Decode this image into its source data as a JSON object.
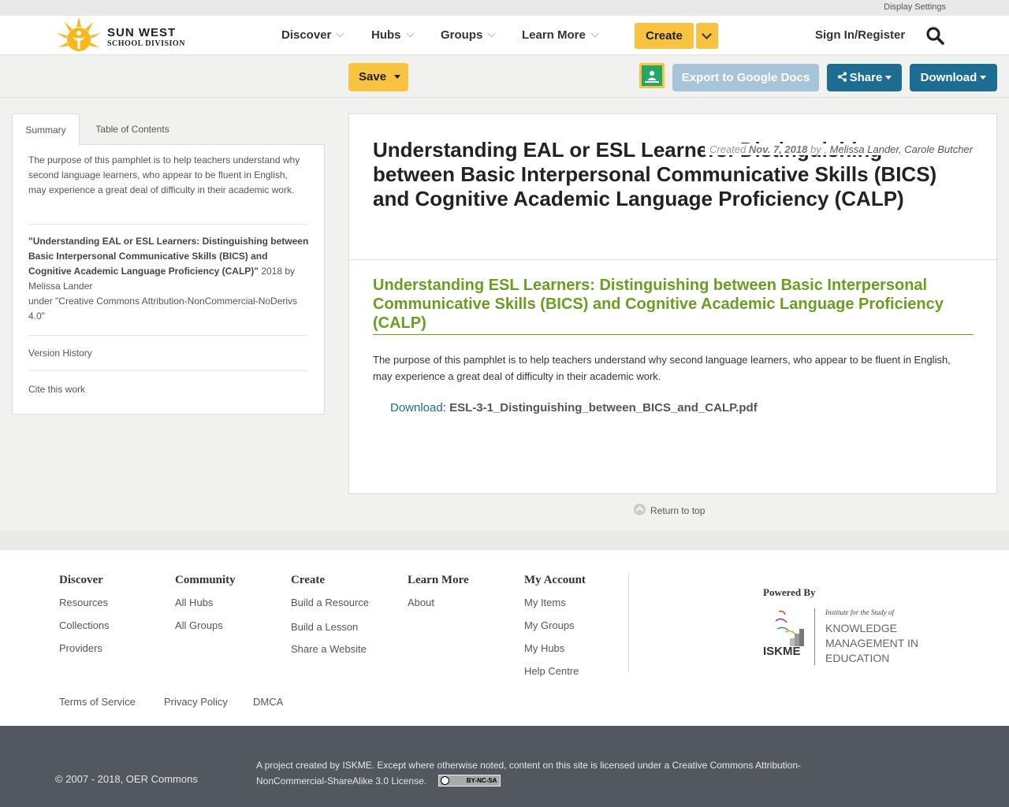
{
  "utility": {
    "display_settings": "Display Settings"
  },
  "logo": {
    "line1": "SUN WEST",
    "line2": "SCHOOL DIVISION"
  },
  "nav": {
    "items": [
      {
        "label": "Discover"
      },
      {
        "label": "Hubs"
      },
      {
        "label": "Groups"
      },
      {
        "label": "Learn More"
      }
    ],
    "create_label": "Create",
    "signin_label": "Sign In/Register"
  },
  "toolbar": {
    "save_label": "Save",
    "export_label": "Export to Google Docs",
    "share_label": "Share",
    "download_label": "Download"
  },
  "sidebar": {
    "tabs": [
      "Summary",
      "Table of Contents"
    ],
    "summary": "The purpose of this pamphlet is to help teachers understand why second language learners, who appear to be fluent in English, may experience a great deal of difficulty in their academic work.",
    "attribution_title": "\"Understanding EAL or ESL Learners: Distinguishing between Basic Interpersonal Communicative Skills (BICS) and Cognitive Academic Language Proficiency (CALP)\"",
    "attribution_year_by": "2018 by",
    "attribution_author": "Melissa Lander",
    "attribution_license": "under \"Creative Commons Attribution-NonCommercial-NoDerivs 4.0\"",
    "version_history": "Version History",
    "cite": "Cite this work"
  },
  "main": {
    "title": "Understanding EAL or ESL Learners: Distinguishing between Basic Interpersonal Communicative Skills (BICS) and Cognitive Academic Language Proficiency (CALP)",
    "created_label": "Created",
    "created_date": "Nov. 7, 2018",
    "by_label": "by ,",
    "author1": "Melissa Lander",
    "author_sep": ",",
    "author2": "Carole Butcher",
    "section_title": "Understanding ESL Learners: Distinguishing between Basic Interpersonal Communicative Skills (BICS) and Cognitive Academic Language Proficiency (CALP)",
    "description": "The purpose of this pamphlet is to help teachers understand why second language learners, who appear to be fluent in English, may experience a great deal of difficulty in their academic work.",
    "download_label": "Download",
    "download_colon": ":",
    "download_file": "ESL-3-1_Distinguishing_between_BICS_and_CALP.pdf",
    "return_top": "Return to top"
  },
  "footer": {
    "discover": {
      "heading": "Discover",
      "links": [
        "Resources",
        "Collections",
        "Providers"
      ]
    },
    "community": {
      "heading": "Community",
      "links": [
        "All Hubs",
        "All Groups"
      ]
    },
    "create": {
      "heading": "Create",
      "links": [
        "Build a Resource",
        "Build a Lesson",
        "Share a Website"
      ]
    },
    "learn_more": {
      "heading": "Learn More",
      "links": [
        "About"
      ]
    },
    "my_account": {
      "heading": "My Account",
      "links": [
        "My Items",
        "My Groups",
        "My Hubs",
        "Help Centre"
      ]
    },
    "legal": [
      "Terms of Service",
      "Privacy Policy",
      "DMCA"
    ],
    "powered_by": "Powered By",
    "iskme_tag": "Institute for the Study of",
    "iskme_name_1": "KNOWLEDGE",
    "iskme_name_2": "MANAGEMENT IN",
    "iskme_name_3": "EDUCATION",
    "iskme_mark": "ISKME"
  },
  "bottom": {
    "copyright": "© 2007 - 2018, OER Commons",
    "project_text": "A project created by ISKME. Except where otherwise noted, content on this site is licensed under a Creative Commons Attribution-NonCommercial-ShareAlike 3.0 License.",
    "cc_badge": "BY-NC-SA"
  },
  "colors": {
    "brand_yellow": "#f7c340",
    "share_blue": "#1d6c92",
    "export_disabled": "#a8c4d8",
    "section_green": "#6a9e1f",
    "footer_dark": "#53575f"
  },
  "icons": {
    "search": "search-icon",
    "share": "share-icon",
    "google_classroom": "google-classroom-icon",
    "return_top": "arrow-up-circle-icon"
  }
}
